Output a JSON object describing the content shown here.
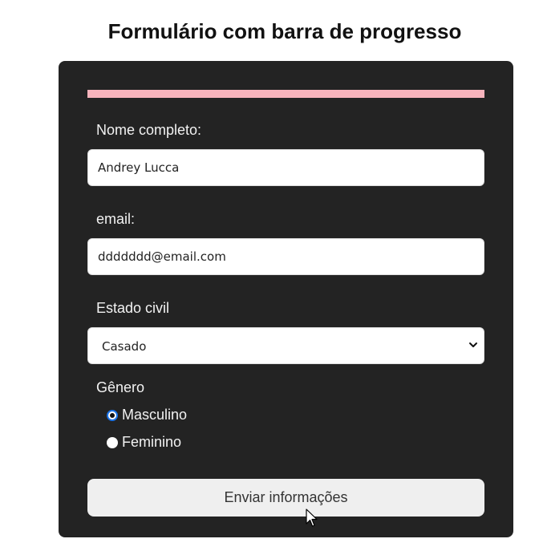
{
  "page": {
    "title": "Formulário com barra de progresso"
  },
  "form": {
    "progress_fraction": 1.0,
    "progress_color": "#f7b3bc",
    "name_label": "Nome completo:",
    "name_value": "Andrey Lucca",
    "email_label": "email:",
    "email_value": "ddddddd@email.com",
    "marital_label": "Estado civil",
    "marital_selected": "Casado",
    "gender_label": "Gênero",
    "gender_options": [
      {
        "label": "Masculino",
        "checked": true
      },
      {
        "label": "Feminino",
        "checked": false
      }
    ],
    "submit_label": "Enviar informações"
  },
  "icons": {
    "select_arrow": "chevron-down-icon",
    "mouse_cursor": "cursor-icon"
  }
}
